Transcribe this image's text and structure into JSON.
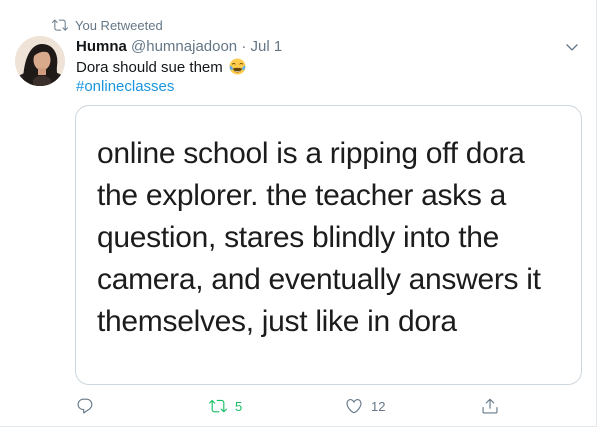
{
  "retweet_context": {
    "label": "You Retweeted",
    "icon": "retweet-icon"
  },
  "tweet": {
    "author_name": "Humna",
    "author_handle": "@humnajadoon",
    "separator": "·",
    "date": "Jul 1",
    "text": "Dora should sue them",
    "emoji": "face-with-tears-of-joy",
    "hashtag": "#onlineclasses",
    "media_text_lines": [
      "online school is a ripping off dora",
      "the explorer. the teacher asks a",
      "question, stares blindly into the",
      "camera, and eventually answers it",
      "themselves, just like in dora"
    ]
  },
  "actions": {
    "reply_count": "",
    "retweet_count": "5",
    "like_count": "12",
    "share_count": ""
  },
  "colors": {
    "retweet_active": "#17bf63",
    "link": "#1b95e0",
    "secondary_text": "#657786",
    "border": "#ccd6dd"
  }
}
